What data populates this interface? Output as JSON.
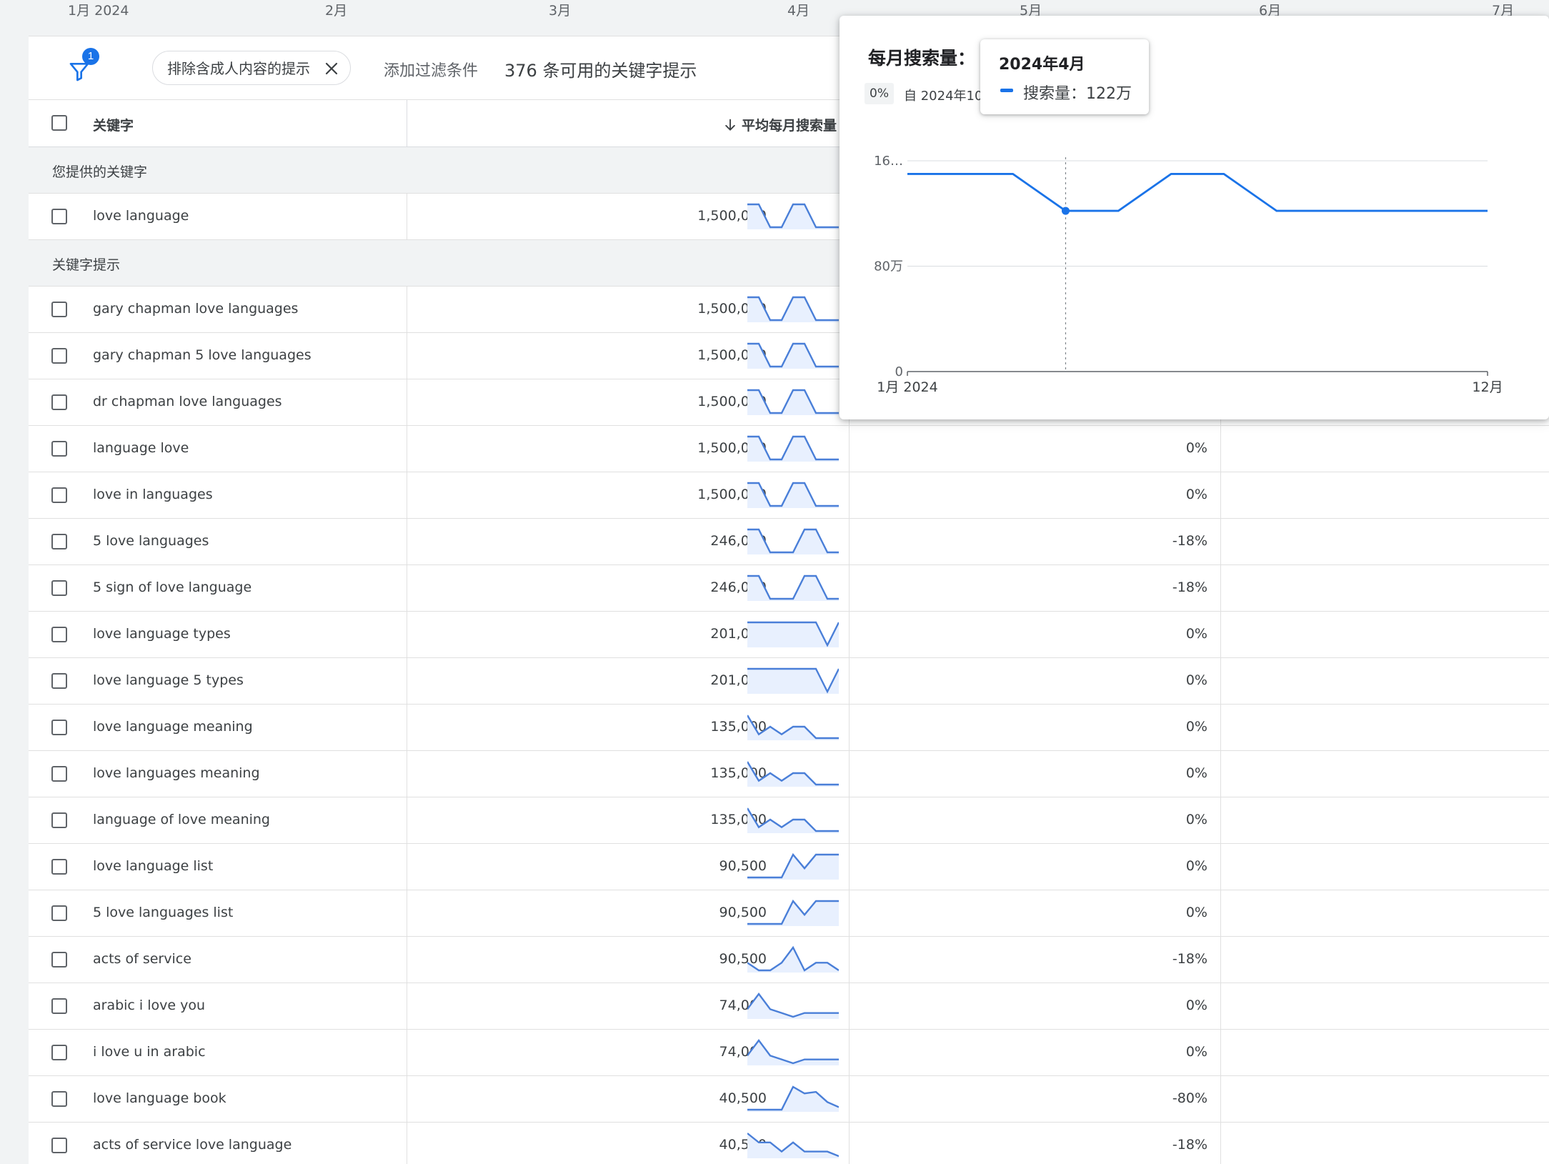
{
  "timeline": {
    "months": [
      "1月 2024",
      "2月",
      "3月",
      "4月",
      "5月",
      "6月",
      "7月"
    ]
  },
  "filter_bar": {
    "badge": "1",
    "chip_label": "排除含成人内容的提示",
    "add_filter": "添加过滤条件",
    "available": "376 条可用的关键字提示"
  },
  "header": {
    "keyword": "关键字",
    "avg_monthly": "平均每月搜索量"
  },
  "sections": {
    "provided": "您提供的关键字",
    "suggestions": "关键字提示"
  },
  "provided_rows": [
    {
      "keyword": "love language",
      "volume": "1,500,000",
      "change": "",
      "trend": [
        16,
        16,
        12.2,
        12.2,
        16,
        16,
        12.2,
        12.2,
        12.2
      ]
    }
  ],
  "suggestion_rows": [
    {
      "keyword": "gary chapman love languages",
      "volume": "1,500,000",
      "change": "",
      "trend": [
        16,
        16,
        12.2,
        12.2,
        16,
        16,
        12.2,
        12.2,
        12.2
      ]
    },
    {
      "keyword": "gary chapman 5 love languages",
      "volume": "1,500,000",
      "change": "",
      "trend": [
        16,
        16,
        12.2,
        12.2,
        16,
        16,
        12.2,
        12.2,
        12.2
      ]
    },
    {
      "keyword": "dr chapman love languages",
      "volume": "1,500,000",
      "change": "",
      "trend": [
        16,
        16,
        12.2,
        12.2,
        16,
        16,
        12.2,
        12.2,
        12.2
      ]
    },
    {
      "keyword": "language love",
      "volume": "1,500,000",
      "change": "0%",
      "trend": [
        16,
        16,
        12.2,
        12.2,
        16,
        16,
        12.2,
        12.2,
        12.2
      ]
    },
    {
      "keyword": "love in languages",
      "volume": "1,500,000",
      "change": "0%",
      "trend": [
        16,
        16,
        12.2,
        12.2,
        16,
        16,
        12.2,
        12.2,
        12.2
      ]
    },
    {
      "keyword": "5 love languages",
      "volume": "246,000",
      "change": "-18%",
      "trend": [
        3,
        3,
        2,
        2,
        2,
        3,
        3,
        2,
        2
      ]
    },
    {
      "keyword": "5 sign of love language",
      "volume": "246,000",
      "change": "-18%",
      "trend": [
        3,
        3,
        2,
        2,
        2,
        3,
        3,
        2,
        2
      ]
    },
    {
      "keyword": "love language types",
      "volume": "201,000",
      "change": "0%",
      "trend": [
        2.2,
        2.2,
        2.2,
        2.2,
        2.2,
        2.2,
        2.2,
        1.6,
        2.2
      ]
    },
    {
      "keyword": "love language 5 types",
      "volume": "201,000",
      "change": "0%",
      "trend": [
        2.2,
        2.2,
        2.2,
        2.2,
        2.2,
        2.2,
        2.2,
        1.6,
        2.2
      ]
    },
    {
      "keyword": "love language meaning",
      "volume": "135,000",
      "change": "0%",
      "trend": [
        1.8,
        1.3,
        1.5,
        1.3,
        1.5,
        1.5,
        1.2,
        1.2,
        1.2
      ]
    },
    {
      "keyword": "love languages meaning",
      "volume": "135,000",
      "change": "0%",
      "trend": [
        1.8,
        1.3,
        1.5,
        1.3,
        1.5,
        1.5,
        1.2,
        1.2,
        1.2
      ]
    },
    {
      "keyword": "language of love meaning",
      "volume": "135,000",
      "change": "0%",
      "trend": [
        1.8,
        1.3,
        1.5,
        1.3,
        1.5,
        1.5,
        1.2,
        1.2,
        1.2
      ]
    },
    {
      "keyword": "love language list",
      "volume": "90,500",
      "change": "0%",
      "trend": [
        0.8,
        0.8,
        0.8,
        0.8,
        1.3,
        1.0,
        1.3,
        1.3,
        1.3
      ]
    },
    {
      "keyword": "5 love languages list",
      "volume": "90,500",
      "change": "0%",
      "trend": [
        0.8,
        0.8,
        0.8,
        0.8,
        1.3,
        1.0,
        1.3,
        1.3,
        1.3
      ]
    },
    {
      "keyword": "acts of service",
      "volume": "90,500",
      "change": "-18%",
      "trend": [
        0.9,
        0.8,
        0.8,
        0.9,
        1.1,
        0.8,
        0.9,
        0.9,
        0.8
      ]
    },
    {
      "keyword": "arabic i love you",
      "volume": "74,000",
      "change": "0%",
      "trend": [
        0.7,
        0.9,
        0.7,
        0.65,
        0.6,
        0.65,
        0.65,
        0.65,
        0.65
      ]
    },
    {
      "keyword": "i love u in arabic",
      "volume": "74,000",
      "change": "0%",
      "trend": [
        0.7,
        0.9,
        0.7,
        0.65,
        0.6,
        0.65,
        0.65,
        0.65,
        0.65
      ]
    },
    {
      "keyword": "love language book",
      "volume": "40,500",
      "change": "-80%",
      "trend": [
        0.3,
        0.3,
        0.3,
        0.3,
        0.75,
        0.62,
        0.65,
        0.45,
        0.35
      ]
    },
    {
      "keyword": "acts of service love language",
      "volume": "40,500",
      "change": "-18%",
      "trend": [
        0.55,
        0.45,
        0.45,
        0.35,
        0.45,
        0.35,
        0.35,
        0.35,
        0.3
      ]
    }
  ],
  "popup": {
    "title": "每月搜索量：",
    "change_pct": "0%",
    "since": "自 2024年10",
    "chart_data": {
      "type": "line",
      "xlabels": [
        "1月 2024",
        "12月"
      ],
      "y_ticks": [
        0,
        80,
        160
      ],
      "y_tick_labels": [
        "0",
        "80万",
        "16…"
      ],
      "ylim": [
        0,
        160
      ],
      "ylabel": "",
      "xlabel": "",
      "series": [
        {
          "name": "搜索量",
          "values": [
            150,
            150,
            150,
            122,
            122,
            150,
            150,
            122,
            122,
            122,
            122,
            122
          ]
        }
      ],
      "highlight_index": 3,
      "grid": true,
      "color": "#1a73e8"
    }
  },
  "tooltip": {
    "month": "2024年4月",
    "value": "搜索量：122万"
  },
  "colors": {
    "accent": "#1a73e8",
    "spark_line": "#4a7fd8",
    "spark_fill": "#e8f0fe"
  }
}
